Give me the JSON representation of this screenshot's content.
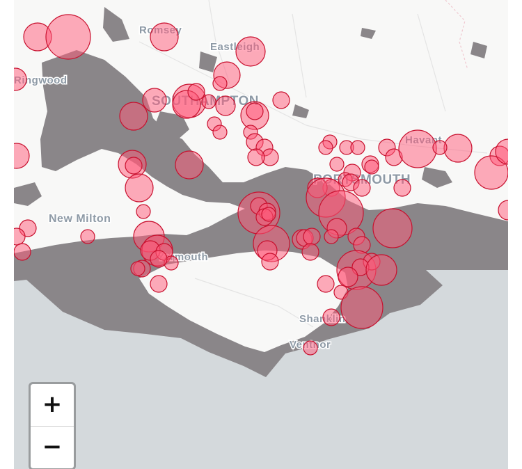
{
  "map": {
    "place_labels": [
      {
        "id": "romsey",
        "text": "Romsey"
      },
      {
        "id": "eastleigh",
        "text": "Eastleigh"
      },
      {
        "id": "southampton",
        "text": "SOUTHAMPTON"
      },
      {
        "id": "portsmouth",
        "text": "PORTSMOUTH"
      },
      {
        "id": "havant",
        "text": "Havant"
      },
      {
        "id": "new-milton",
        "text": "New Milton"
      },
      {
        "id": "yarmouth",
        "text": "Yarmouth"
      },
      {
        "id": "shanklin",
        "text": "Shanklin"
      },
      {
        "id": "ventnor",
        "text": "Ventnor"
      },
      {
        "id": "ringwood",
        "text": "Ringwood"
      }
    ],
    "colors": {
      "sea": "#d4d9dc",
      "land": "#f8f8f7",
      "forest_overlay": "#8a8689",
      "marker_fill": "#ff5a7a",
      "marker_stroke": "#c8102e"
    }
  },
  "zoom": {
    "in_label": "+",
    "out_label": "−"
  }
}
